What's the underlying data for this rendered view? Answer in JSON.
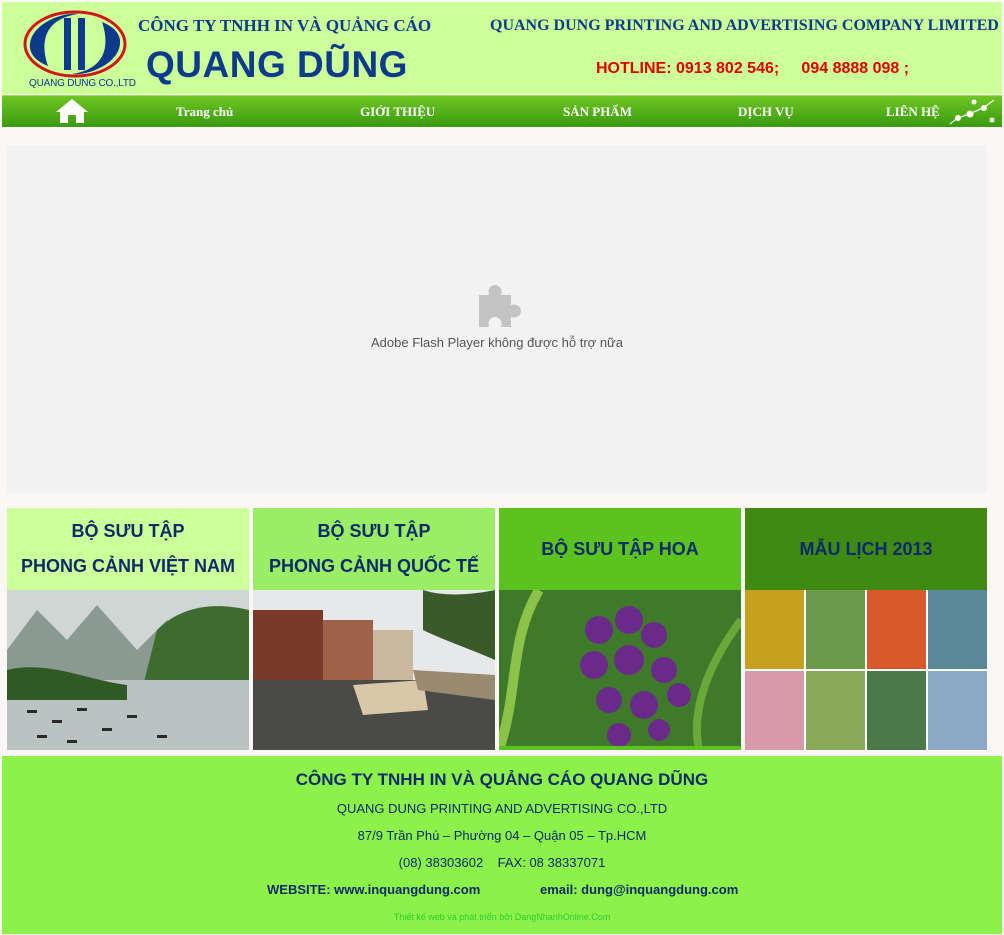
{
  "header": {
    "logo_caption": "QUANG DUNG CO.,LTD",
    "company_vn": "CÔNG TY TNHH IN VÀ QUẢNG CÁO",
    "brand": "QUANG DŨNG",
    "company_en": "QUANG DUNG PRINTING AND ADVERTISING COMPANY LIMITED",
    "hotline": "HOTLINE: 0913 802 546;     094 8888 098 ;"
  },
  "nav": {
    "home_icon": "home-icon",
    "items": [
      "Trang chủ",
      "GIỚI THIỆU",
      "SẢN PHẨM",
      "DỊCH VỤ",
      "LIÊN HỆ"
    ]
  },
  "flash": {
    "icon": "puzzle-plugin-icon",
    "message": "Adobe Flash Player không được hỗ trợ nữa"
  },
  "collections": [
    {
      "line1": "BỘ SƯU TẬP",
      "line2": "PHONG CẢNH VIỆT NAM",
      "bg": "#ccff99"
    },
    {
      "line1": "BỘ SƯU TẬP",
      "line2": "PHONG CẢNH QUỐC TẾ",
      "bg": "#99ee66"
    },
    {
      "line1": "BỘ SƯU TẬP HOA",
      "line2": "",
      "bg": "#5cc21e"
    },
    {
      "line1": "MẪU LỊCH 2013",
      "line2": "",
      "bg": "#3e8a12"
    }
  ],
  "footer": {
    "title": "CÔNG TY TNHH IN VÀ QUẢNG CÁO QUANG DŨNG",
    "company_en": "QUANG DUNG PRINTING AND ADVERTISING CO.,LTD",
    "address": "87/9 Trần Phú – Phường 04 – Quận 05 – Tp.HCM",
    "phone": "(08) 38303602    FAX: 08 38337071",
    "website": "WEBSITE: www.inquangdung.com",
    "email": "email: dung@inquangdung.com",
    "credit": "Thiết kế web và phát triển bởi DangNhanhOnline.Com"
  }
}
